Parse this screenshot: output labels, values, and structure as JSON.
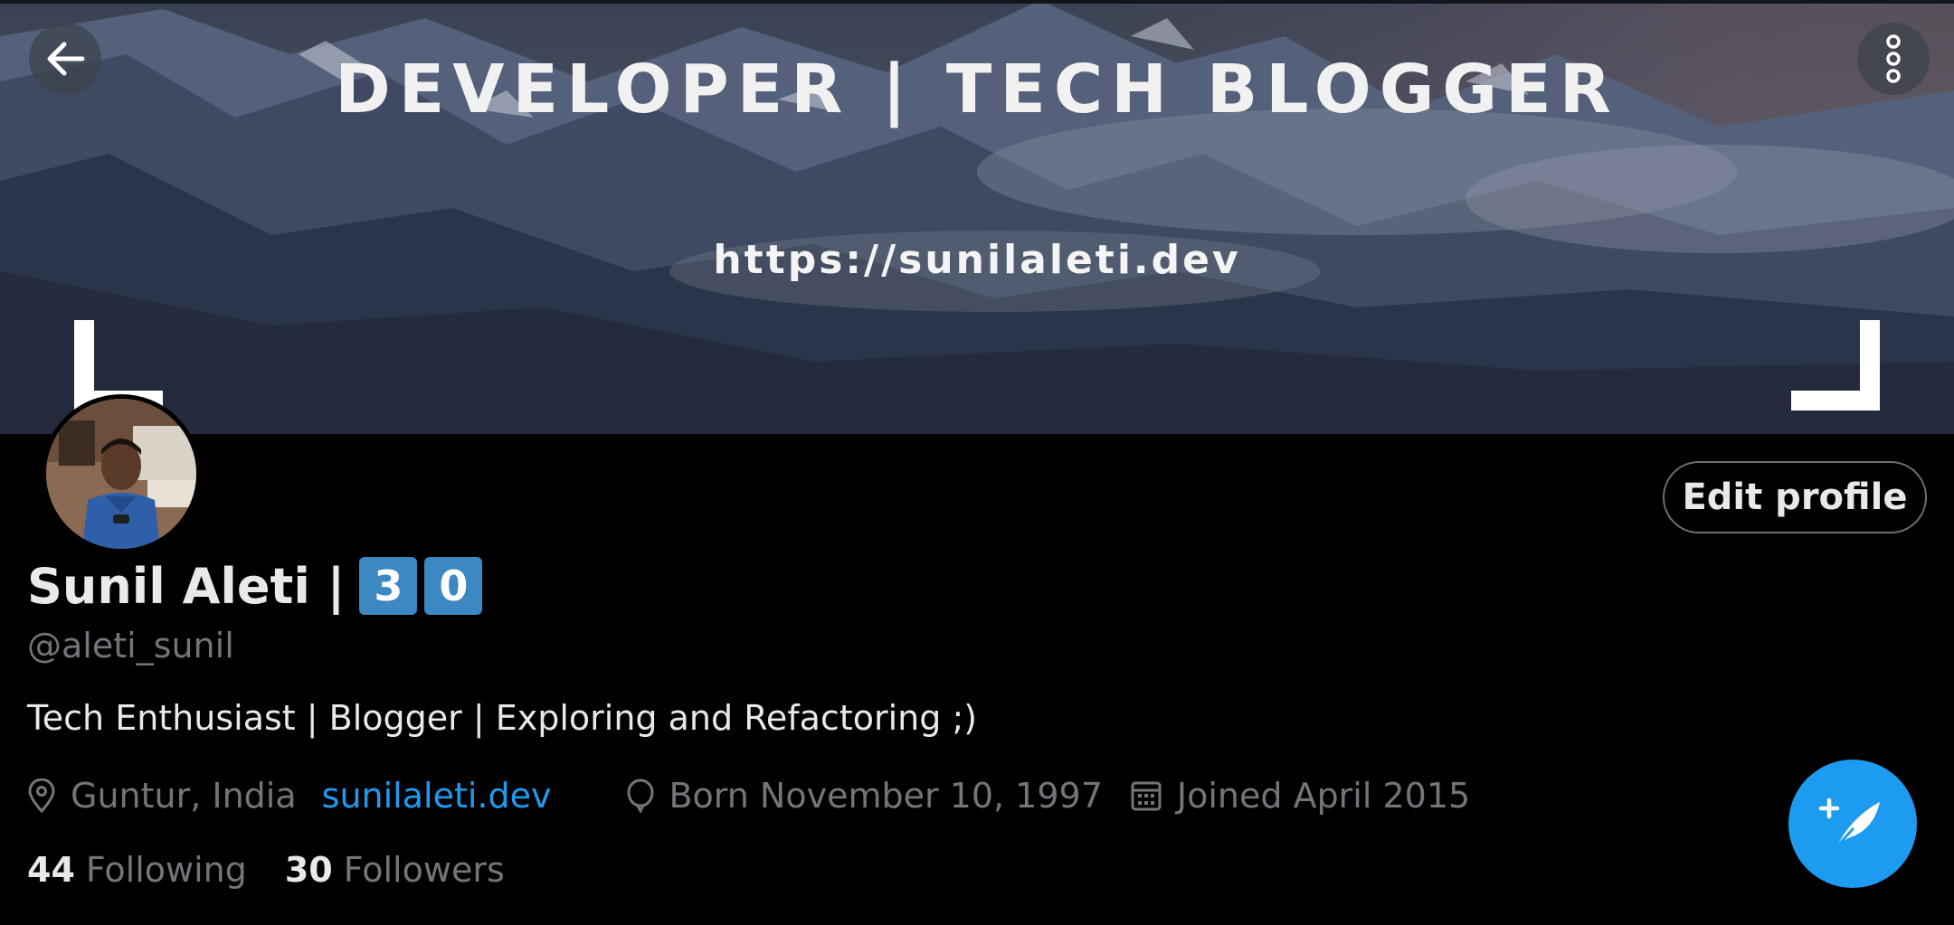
{
  "banner": {
    "title": "DEVELOPER | TECH BLOGGER",
    "url": "https://sunilaleti.dev"
  },
  "nav": {
    "back_icon": "arrow-left-icon",
    "menu_icon": "more-vertical-icon"
  },
  "profile": {
    "name": "Sunil Aleti |",
    "badge_digits": [
      "3",
      "0"
    ],
    "handle": "@aleti_sunil",
    "bio": "Tech Enthusiast | Blogger | Exploring and Refactoring ;)",
    "location": "Guntur, India",
    "website": "sunilaleti.dev",
    "born": "Born November 10, 1997",
    "joined": "Joined April 2015",
    "following_count": "44",
    "following_label": "Following",
    "followers_count": "30",
    "followers_label": "Followers"
  },
  "actions": {
    "edit_profile_label": "Edit profile",
    "compose_icon": "compose-tweet-icon"
  },
  "colors": {
    "accent": "#1d9bf0",
    "keycap": "#3b88c3",
    "background": "#000000",
    "secondary_text": "#71767b"
  }
}
